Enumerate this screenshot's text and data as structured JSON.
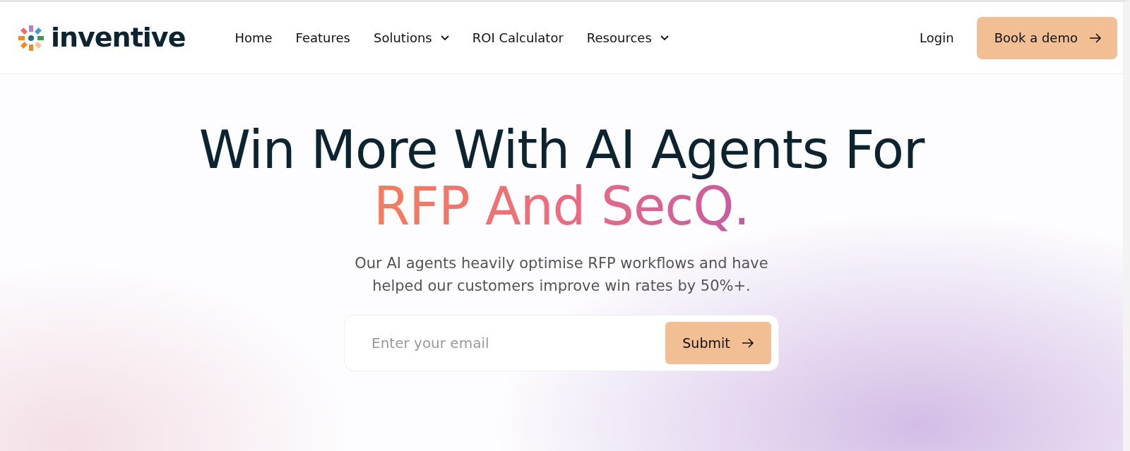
{
  "brand": {
    "name": "inventive"
  },
  "nav": [
    {
      "label": "Home",
      "dropdown": false
    },
    {
      "label": "Features",
      "dropdown": false
    },
    {
      "label": "Solutions",
      "dropdown": true
    },
    {
      "label": "ROI Calculator",
      "dropdown": false
    },
    {
      "label": "Resources",
      "dropdown": true
    }
  ],
  "login": "Login",
  "cta": "Book a demo",
  "hero": {
    "title": "Win More With AI Agents For",
    "highlight": "RFP And SecQ.",
    "subtitle": "Our AI agents heavily optimise RFP workflows and have helped our customers improve win rates by 50%+."
  },
  "signup": {
    "placeholder": "Enter your email",
    "button": "Submit"
  }
}
